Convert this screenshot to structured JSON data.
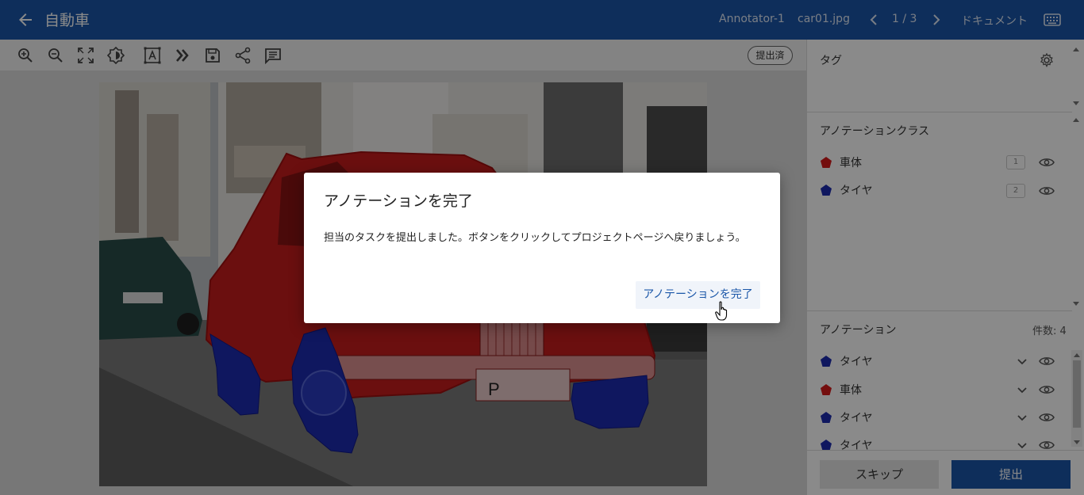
{
  "header": {
    "title": "自動車",
    "annotator": "Annotator-1",
    "filename": "car01.jpg",
    "page": "1 / 3",
    "document_label": "ドキュメント",
    "icons": [
      "back-arrow-icon",
      "chevron-left-icon",
      "chevron-right-icon",
      "keyboard-icon"
    ]
  },
  "toolbar": {
    "icons": [
      "zoom-in-icon",
      "zoom-out-icon",
      "fit-screen-icon",
      "brightness-icon",
      "text-select-icon",
      "double-chevron-icon",
      "save-icon",
      "share-icon",
      "comment-icon"
    ],
    "status_badge": "提出済"
  },
  "panel": {
    "tags_title": "タグ",
    "classes_title": "アノテーションクラス",
    "classes": [
      {
        "label": "車体",
        "key": "1",
        "color": "#d61a1a"
      },
      {
        "label": "タイヤ",
        "key": "2",
        "color": "#1c2bb0"
      }
    ],
    "annotations_title": "アノテーション",
    "annotations_count": "件数: 4",
    "annotations": [
      {
        "label": "タイヤ",
        "color": "#1c2bb0"
      },
      {
        "label": "車体",
        "color": "#d61a1a"
      },
      {
        "label": "タイヤ",
        "color": "#1c2bb0"
      },
      {
        "label": "タイヤ",
        "color": "#1c2bb0"
      }
    ],
    "skip_label": "スキップ",
    "submit_label": "提出"
  },
  "dialog": {
    "title": "アノテーションを完了",
    "body": "担当のタスクを提出しました。ボタンをクリックしてプロジェクトページへ戻りましょう。",
    "button_label": "アノテーションを完了"
  },
  "colors": {
    "header_bg": "#1a56a8",
    "accent": "#1a56a8",
    "car_body": "#d61a1a",
    "tire": "#1c2bb0"
  }
}
